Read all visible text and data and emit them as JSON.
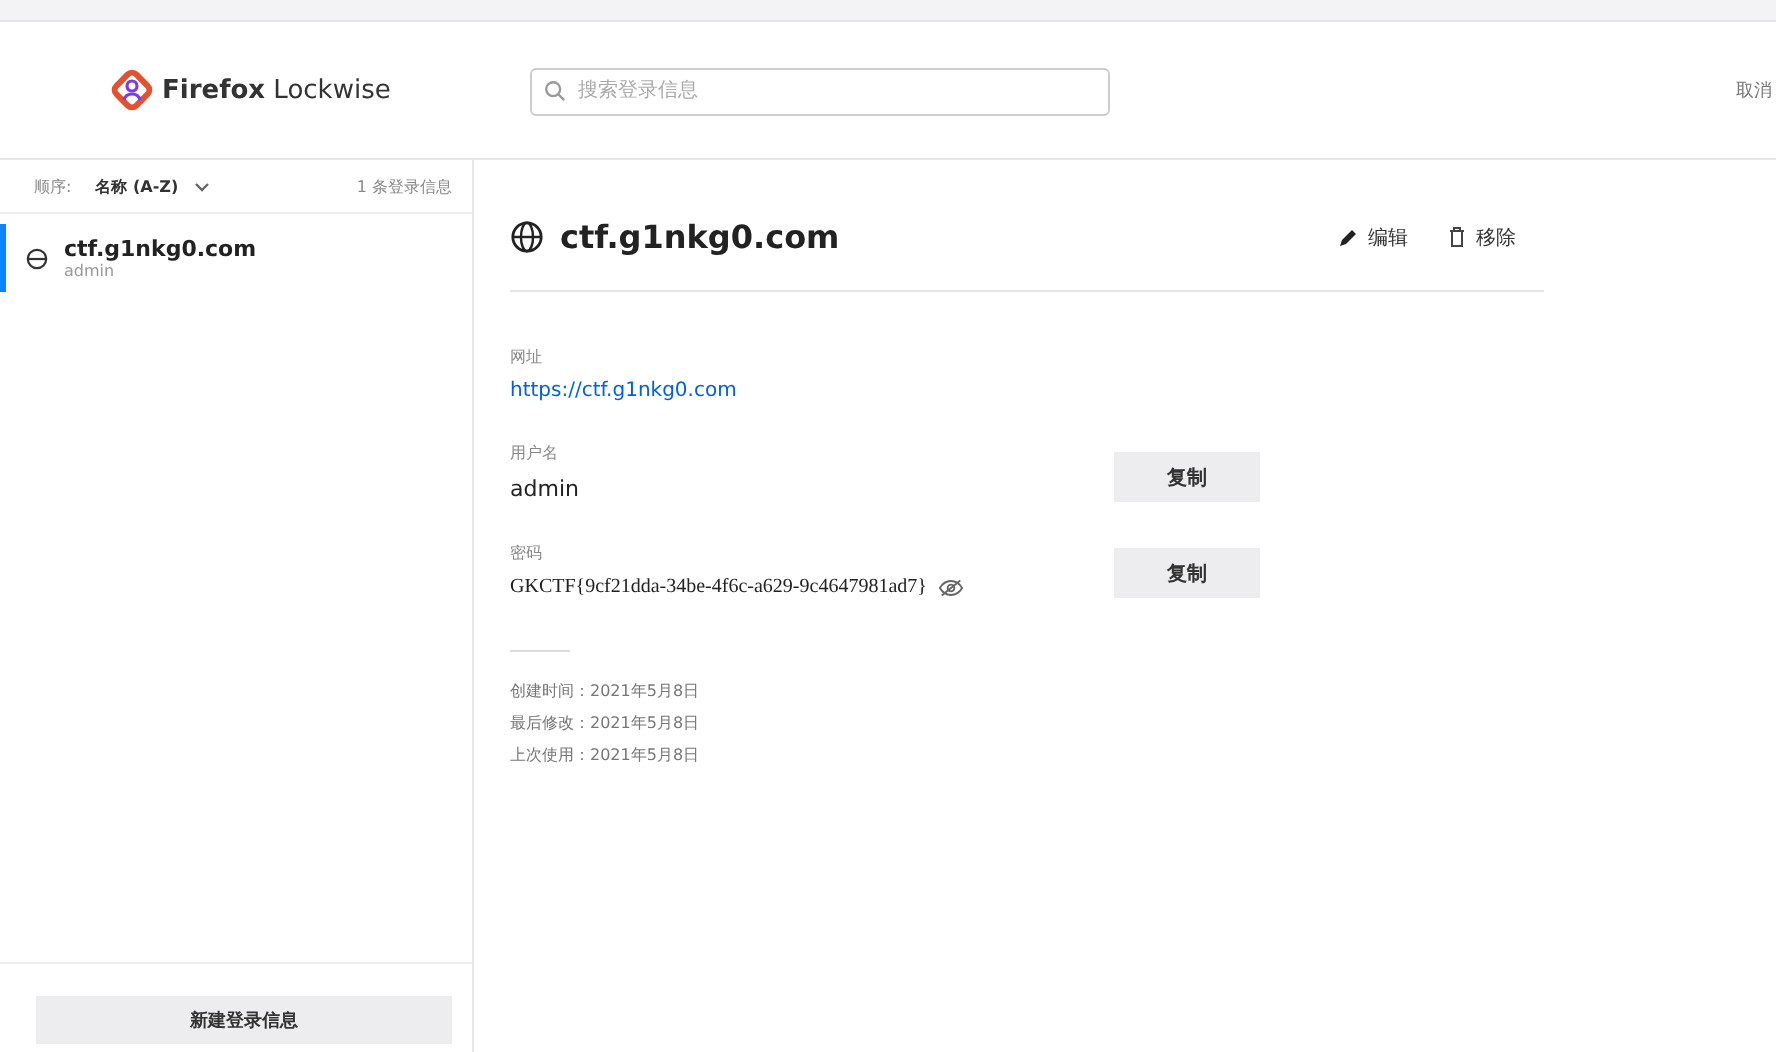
{
  "header": {
    "brand_bold": "Firefox",
    "brand_light": "Lockwise",
    "search": {
      "placeholder": "搜索登录信息"
    },
    "cut_action": "取消"
  },
  "sidebar": {
    "sort_label": "顺序:",
    "sort_value": "名称 (A-Z)",
    "count": "1 条登录信息",
    "items": [
      {
        "title": "ctf.g1nkg0.com",
        "subtitle": "admin",
        "selected": true
      }
    ],
    "new_button": "新建登录信息"
  },
  "detail": {
    "title": "ctf.g1nkg0.com",
    "actions": [
      {
        "kind": "edit",
        "label": "编辑"
      },
      {
        "kind": "remove",
        "label": "移除"
      }
    ],
    "fields": [
      {
        "kind": "link",
        "label": "网址",
        "value": "https://ctf.g1nkg0.com"
      },
      {
        "kind": "text",
        "label": "用户名",
        "value": "admin",
        "copy": "复制"
      },
      {
        "kind": "password",
        "label": "密码",
        "value": "GKCTF{9cf21dda-34be-4f6c-a629-9c4647981ad7}",
        "copy": "复制"
      }
    ],
    "dates": [
      "创建时间：2021年5月8日",
      "最后修改：2021年5月8日",
      "上次使用：2021年5月8日"
    ]
  }
}
